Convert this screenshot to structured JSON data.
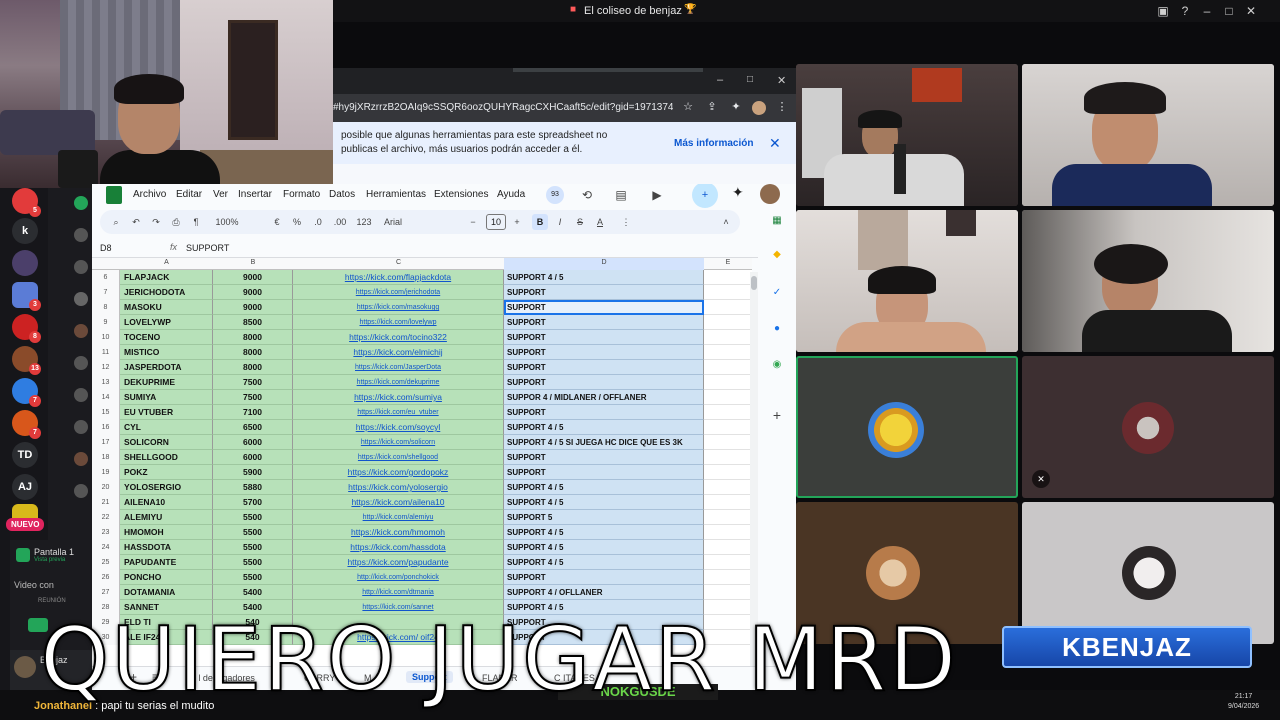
{
  "window": {
    "title": "El coliseo de benjaz",
    "title_emoji": "🏆"
  },
  "browser": {
    "url": "#hy9jXRzrrzB2OAIq9cSSQR6oozQUHYRagcCXHCaaft5c/edit?gid=1971374736#gid...",
    "info_line1": "posible que algunas herramientas para este spreadsheet no",
    "info_line2": "publicas el archivo, más usuarios podrán acceder a él.",
    "info_more": "Más información",
    "info_close": "✕"
  },
  "sheets": {
    "menu": [
      "Archivo",
      "Editar",
      "Ver",
      "Insertar",
      "Formato",
      "Datos",
      "Herramientas",
      "Extensiones",
      "Ayuda"
    ],
    "badge": "93",
    "toolbar": {
      "zoom": "100%",
      "currency": "€",
      "percent": "%",
      "dec_less": ".0",
      "dec_more": ".00",
      "num": "123",
      "font": "Arial",
      "size": "10",
      "minus": "−",
      "plus": "+",
      "bold": "B",
      "italic": "I",
      "strike": "S",
      "color": "A"
    },
    "cell_ref": "D8",
    "formula_value": "SUPPORT",
    "columns": [
      "A",
      "B",
      "C",
      "D",
      "E"
    ],
    "rows": [
      {
        "n": "6",
        "name": "FLAPJACK",
        "mmr": "9000",
        "link": "https://kick.com/flapjackdota",
        "role": "SUPPORT 4 / 5",
        "small": false,
        "sel": false
      },
      {
        "n": "7",
        "name": "JERICHODOTA",
        "mmr": "9000",
        "link": "https://kick.com/jerichodota",
        "role": "SUPPORT",
        "small": true,
        "sel": false
      },
      {
        "n": "8",
        "name": "MASOKU",
        "mmr": "9000",
        "link": "https://kick.com/masokugg",
        "role": "SUPPORT",
        "small": true,
        "sel": true
      },
      {
        "n": "9",
        "name": "LOVELYWP",
        "mmr": "8500",
        "link": "https://kick.com/lovelywp",
        "role": "SUPPORT",
        "small": true,
        "sel": false
      },
      {
        "n": "10",
        "name": "TOCENO",
        "mmr": "8000",
        "link": "https://kick.com/tocino322",
        "role": "SUPPORT",
        "small": false,
        "sel": false
      },
      {
        "n": "11",
        "name": "MISTICO",
        "mmr": "8000",
        "link": "https://kick.com/elmichij",
        "role": "SUPPORT",
        "small": false,
        "sel": false
      },
      {
        "n": "12",
        "name": "JASPERDOTA",
        "mmr": "8000",
        "link": "https://kick.com/JasperDota",
        "role": "SUPPORT",
        "small": true,
        "sel": false
      },
      {
        "n": "13",
        "name": "DEKUPRIME",
        "mmr": "7500",
        "link": "https://kick.com/dekuprime",
        "role": "SUPPORT",
        "small": true,
        "sel": false
      },
      {
        "n": "14",
        "name": "SUMIYA",
        "mmr": "7500",
        "link": "https://kick.com/sumiya",
        "role": "SUPPOR 4 / MIDLANER / OFFLANER",
        "small": false,
        "sel": false
      },
      {
        "n": "15",
        "name": "EU VTUBER",
        "mmr": "7100",
        "link": "https://kick.com/eu_vtuber",
        "role": "SUPPORT",
        "small": true,
        "sel": false
      },
      {
        "n": "16",
        "name": "CYL",
        "mmr": "6500",
        "link": "https://kick.com/soycyl",
        "role": "SUPPORT 4 / 5",
        "small": false,
        "sel": false
      },
      {
        "n": "17",
        "name": "SOLICORN",
        "mmr": "6000",
        "link": "https://kick.com/solicorn",
        "role": "SUPPORT 4 / 5 SI JUEGA HC DICE QUE ES 3K",
        "small": true,
        "sel": false
      },
      {
        "n": "18",
        "name": "SHELLGOOD",
        "mmr": "6000",
        "link": "https://kick.com/shellgood",
        "role": "SUPPORT",
        "small": true,
        "sel": false
      },
      {
        "n": "19",
        "name": "POKZ",
        "mmr": "5900",
        "link": "https://kick.com/gordopokz",
        "role": "SUPPORT",
        "small": false,
        "sel": false
      },
      {
        "n": "20",
        "name": "YOLOSERGIO",
        "mmr": "5880",
        "link": "https://kick.com/yolosergio",
        "role": "SUPPORT 4 / 5",
        "small": false,
        "sel": false
      },
      {
        "n": "21",
        "name": "AILENA10",
        "mmr": "5700",
        "link": "https://kick.com/ailena10",
        "role": "SUPPORT 4 / 5",
        "small": false,
        "sel": false
      },
      {
        "n": "22",
        "name": "ALEMIYU",
        "mmr": "5500",
        "link": "http://kick.com/alemiyu",
        "role": "SUPPORT 5",
        "small": true,
        "sel": false
      },
      {
        "n": "23",
        "name": "HMOMOH",
        "mmr": "5500",
        "link": "https://kick.com/hmomoh",
        "role": "SUPPORT 4 / 5",
        "small": false,
        "sel": false
      },
      {
        "n": "24",
        "name": "HASSDOTA",
        "mmr": "5500",
        "link": "https://kick.com/hassdota",
        "role": "SUPPORT 4 / 5",
        "small": false,
        "sel": false
      },
      {
        "n": "25",
        "name": "PAPUDANTE",
        "mmr": "5500",
        "link": "https://kick.com/papudante",
        "role": "SUPPORT 4 / 5",
        "small": false,
        "sel": false
      },
      {
        "n": "26",
        "name": "PONCHO",
        "mmr": "5500",
        "link": "http://kick.com/ponchokick",
        "role": "SUPPORT",
        "small": true,
        "sel": false
      },
      {
        "n": "27",
        "name": "DOTAMANIA",
        "mmr": "5400",
        "link": "http://kick.com/dtmania",
        "role": "SUPPORT 4 / OFLLANER",
        "small": true,
        "sel": false
      },
      {
        "n": "28",
        "name": "SANNET",
        "mmr": "5400",
        "link": "https://kick.com/sannet",
        "role": "SUPPORT 4 / 5",
        "small": true,
        "sel": false
      },
      {
        "n": "29",
        "name": "ELD  TI",
        "mmr": "540",
        "link": "",
        "role": "SUPPORT",
        "small": true,
        "sel": false
      },
      {
        "n": "30",
        "name": "ALE  IF24",
        "mmr": "540",
        "link": "https://kick.com/  oif24",
        "role": "SUPPORT",
        "small": false,
        "sel": false
      }
    ],
    "tabs": [
      "+",
      "≡",
      "P  l de jugadores",
      "CARRY",
      "M  ",
      "Support",
      "  FLANER",
      "C  ITANES"
    ]
  },
  "discord": {
    "servers": [
      "",
      "k",
      "",
      "",
      "",
      "",
      "",
      "",
      "",
      "TD",
      "AJ",
      ""
    ],
    "nuevo": "NUEVO",
    "pantalla": "Pantalla 1",
    "pantalla_sub": "Vista previa",
    "video": "Video con",
    "video_sub": "REUNIÓN",
    "username": "Benjaz"
  },
  "tiles": {
    "banner": "KBENJAZ",
    "green_banner": "NOKGUSDE"
  },
  "chat": {
    "user": "Jonathanel",
    "message": "papi tu serias el mudito"
  },
  "clock": {
    "time": "21:17",
    "date": "9/04/2026"
  },
  "overlay_text": "QUIERO JUGAR MRD",
  "colors": {
    "sheet_green": "#b7e1b9",
    "sheet_blue": "#cfe2f3",
    "link": "#1155cc",
    "discord_bg": "#16161a",
    "accent_blue": "#0b57d0"
  }
}
